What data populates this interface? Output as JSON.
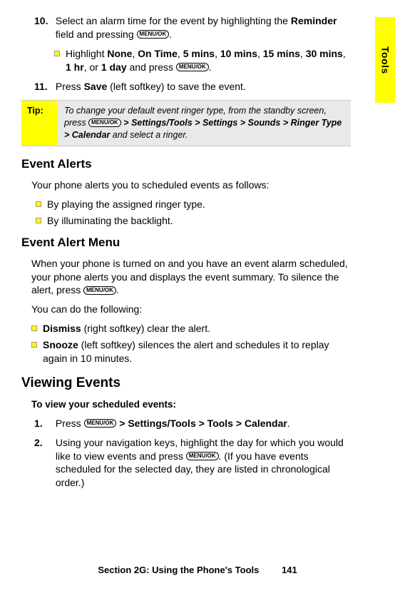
{
  "sideTab": "Tools",
  "menuOkGlyph": "MENU/OK",
  "step10": {
    "num": "10.",
    "preText": "Select an alarm time for the event by highlighting the ",
    "boldField": "Reminder",
    "midText": " field and pressing ",
    "postText": ".",
    "sub": {
      "pre": "Highlight ",
      "opts": [
        "None",
        "On Time",
        "5 mins",
        "10 mins",
        "15 mins",
        "30 mins",
        "1 hr",
        "1 day"
      ],
      "joinMid": ", ",
      "joinLast": ", or ",
      "mid": " and press ",
      "post": "."
    }
  },
  "step11": {
    "num": "11.",
    "pre": "Press ",
    "bold": "Save",
    "post": " (left softkey) to save the event."
  },
  "tip": {
    "label": "Tip:",
    "pre": "To change your default event ringer type, from the standby screen, press ",
    "chain": " > Settings/Tools > Settings > Sounds > Ringer Type > Calendar",
    "post": " and select a ringer."
  },
  "alerts": {
    "heading": "Event Alerts",
    "intro": "Your phone alerts you to scheduled events as follows:",
    "b1": "By playing the assigned ringer type.",
    "b2": "By illuminating the backlight."
  },
  "alertMenu": {
    "heading": "Event Alert Menu",
    "p1pre": "When your phone is turned on and you have an event alarm scheduled, your phone alerts you and displays the event summary. To silence the alert, press ",
    "p1post": ".",
    "p2": "You can do the following:",
    "b1bold": "Dismiss",
    "b1rest": " (right softkey) clear the alert.",
    "b2bold": "Snooze",
    "b2rest": " (left softkey) silences the alert and schedules it to replay again in 10 minutes."
  },
  "viewing": {
    "heading": "Viewing Events",
    "toLine": "To view your scheduled events:",
    "s1": {
      "num": "1.",
      "pre": "Press ",
      "chain": " > Settings/Tools > Tools > Calendar",
      "post": "."
    },
    "s2": {
      "num": "2.",
      "pre": "Using your navigation keys, highlight the day for which you would like to view events and press ",
      "post": ". (If you have events scheduled for the selected day, they are listed in chronological order.)"
    }
  },
  "footer": {
    "section": "Section 2G: Using the Phone's Tools",
    "page": "141"
  }
}
